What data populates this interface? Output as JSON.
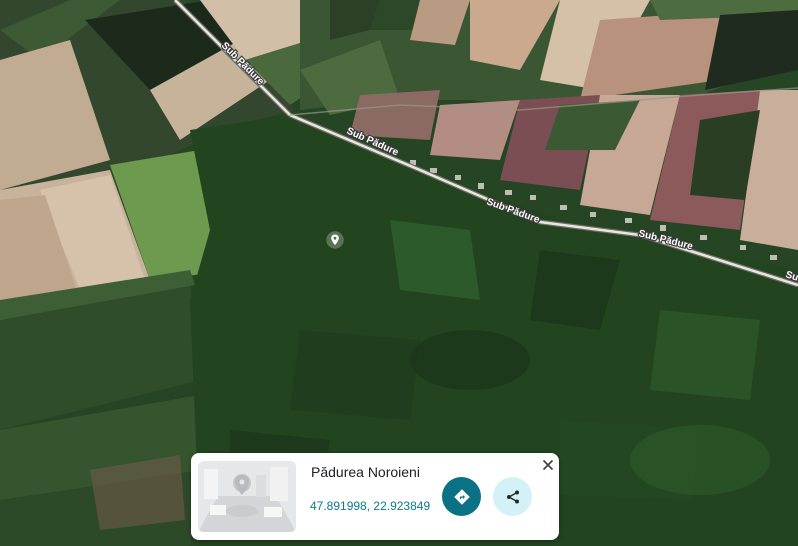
{
  "map": {
    "view": "satellite",
    "roads": [
      {
        "label": "Sub Pădure"
      },
      {
        "label": "Sub Pădure"
      },
      {
        "label": "Sub Pădure"
      },
      {
        "label": "Sub Pădure"
      },
      {
        "label": "Sub Pădure"
      }
    ],
    "pin_icon": "place-marker-icon"
  },
  "place_card": {
    "name": "Pădurea Noroieni",
    "coordinates": "47.891998, 22.923849",
    "directions_icon": "directions-icon",
    "share_icon": "share-icon",
    "close_icon": "close-icon",
    "colors": {
      "directions_bg": "#0b7285",
      "share_bg": "#d3f1f6",
      "link": "#0b7a8a"
    }
  }
}
